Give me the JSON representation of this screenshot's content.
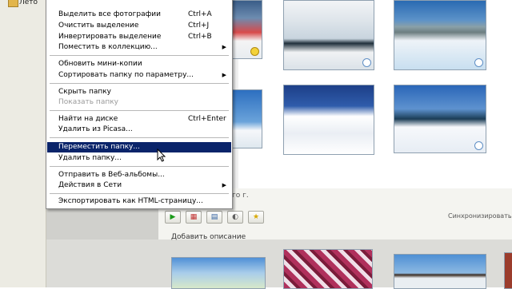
{
  "left_pane": {
    "folder_label": "Лето"
  },
  "context_menu": {
    "items": [
      {
        "label": "Выделить все фотографии",
        "shortcut": "Ctrl+A"
      },
      {
        "label": "Очистить выделение",
        "shortcut": "Ctrl+J"
      },
      {
        "label": "Инвертировать выделение",
        "shortcut": "Ctrl+B"
      },
      {
        "label": "Поместить в коллекцию...",
        "shortcut": ""
      },
      {
        "label": "Обновить мини-копии",
        "shortcut": ""
      },
      {
        "label": "Сортировать папку по параметру...",
        "shortcut": ""
      },
      {
        "label": "Скрыть папку",
        "shortcut": ""
      },
      {
        "label": "Показать папку",
        "shortcut": ""
      },
      {
        "label": "Найти на диске",
        "shortcut": "Ctrl+Enter"
      },
      {
        "label": "Удалить из Picasa...",
        "shortcut": ""
      },
      {
        "label": "Переместить папку...",
        "shortcut": ""
      },
      {
        "label": "Удалить папку...",
        "shortcut": ""
      },
      {
        "label": "Отправить в Веб-альбомы...",
        "shortcut": ""
      },
      {
        "label": "Действия в Сети",
        "shortcut": ""
      },
      {
        "label": "Экспортировать как HTML-страницу...",
        "shortcut": ""
      }
    ]
  },
  "album": {
    "date_fragment": "го г.",
    "sync_label": "Синхронизировать с И",
    "add_description": "Добавить описание",
    "toolbar_icons": [
      "play-icon",
      "slideshow-icon",
      "export-icon",
      "sync-icon",
      "star-icon"
    ]
  },
  "colors": {
    "menu_highlight": "#0a246a",
    "menu_disabled": "#9a9a9a"
  }
}
